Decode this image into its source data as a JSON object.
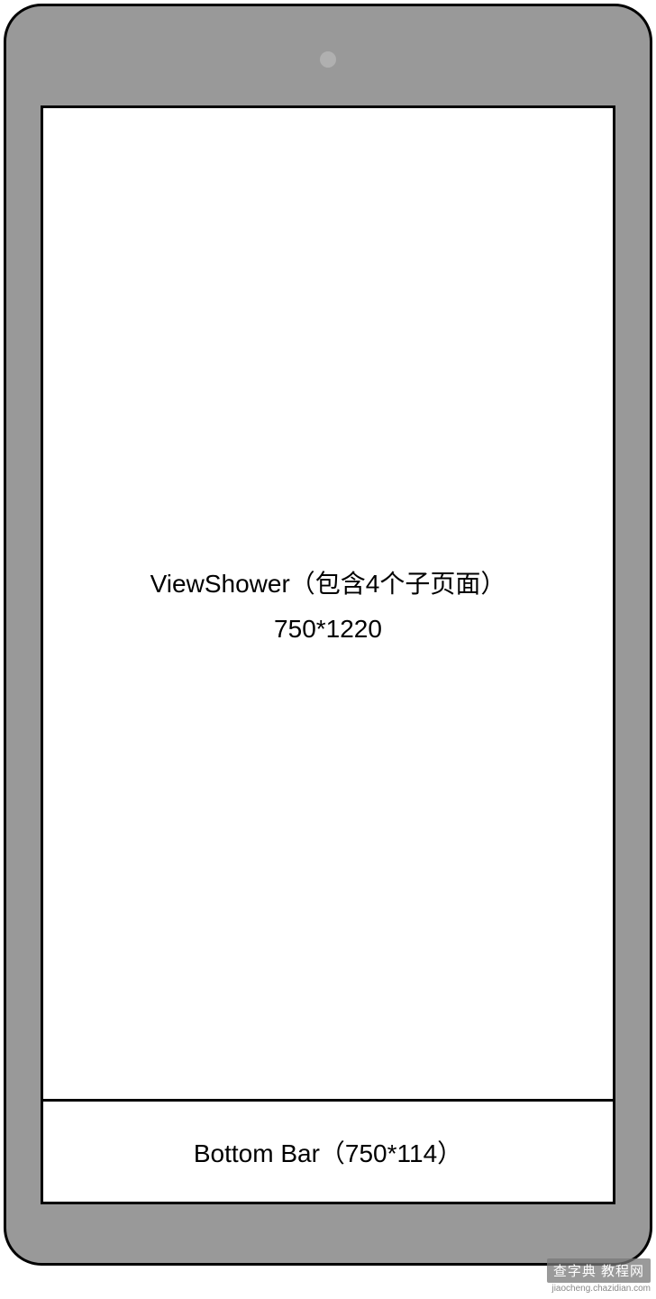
{
  "viewShower": {
    "title": "ViewShower（包含4个子页面）",
    "size": "750*1220"
  },
  "bottomBar": {
    "label": "Bottom Bar（750*114）"
  },
  "watermark": {
    "text": "查字典 教程网",
    "url": "jiaocheng.chazidian.com"
  }
}
